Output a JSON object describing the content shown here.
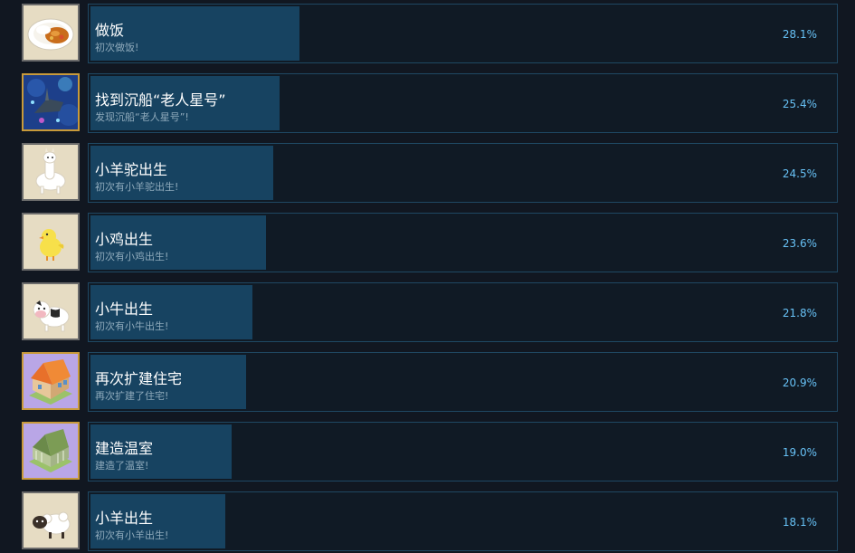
{
  "achievements": [
    {
      "title": "做饭",
      "description": "初次做饭!",
      "percent_text": "28.1%",
      "percent": 28.1,
      "icon": "curry-rice-icon",
      "border": "gray"
    },
    {
      "title": "找到沉船“老人星号”",
      "description": "发现沉船“老人星号”!",
      "percent_text": "25.4%",
      "percent": 25.4,
      "icon": "shipwreck-icon",
      "border": "gold"
    },
    {
      "title": "小羊驼出生",
      "description": "初次有小羊驼出生!",
      "percent_text": "24.5%",
      "percent": 24.5,
      "icon": "alpaca-icon",
      "border": "gray"
    },
    {
      "title": "小鸡出生",
      "description": "初次有小鸡出生!",
      "percent_text": "23.6%",
      "percent": 23.6,
      "icon": "chick-icon",
      "border": "gray"
    },
    {
      "title": "小牛出生",
      "description": "初次有小牛出生!",
      "percent_text": "21.8%",
      "percent": 21.8,
      "icon": "calf-icon",
      "border": "gray"
    },
    {
      "title": "再次扩建住宅",
      "description": "再次扩建了住宅!",
      "percent_text": "20.9%",
      "percent": 20.9,
      "icon": "house-icon",
      "border": "gold"
    },
    {
      "title": "建造温室",
      "description": "建造了温室!",
      "percent_text": "19.0%",
      "percent": 19.0,
      "icon": "greenhouse-icon",
      "border": "gold"
    },
    {
      "title": "小羊出生",
      "description": "初次有小羊出生!",
      "percent_text": "18.1%",
      "percent": 18.1,
      "icon": "lamb-icon",
      "border": "gray"
    }
  ],
  "colors": {
    "background": "#111721",
    "bar_fill": "#174361",
    "bar_border": "#1f4863",
    "percent_text": "#67c1f5",
    "description_text": "#8faabb",
    "gold_border": "#c89a3a"
  }
}
